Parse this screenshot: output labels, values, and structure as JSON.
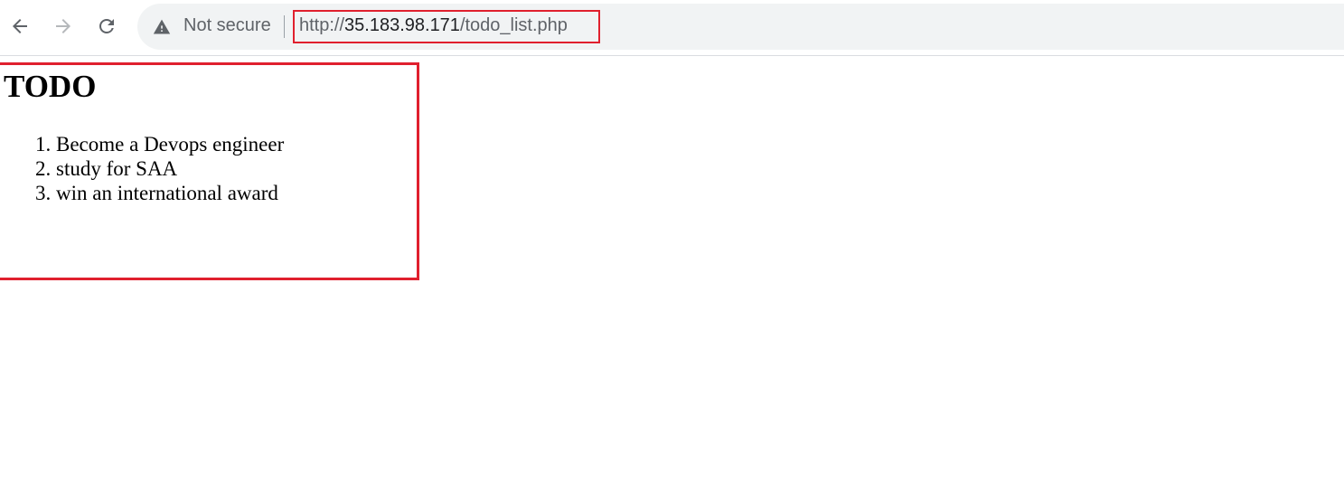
{
  "browser": {
    "nav": {
      "back_icon": "arrow-left-icon",
      "forward_icon": "arrow-right-icon",
      "reload_icon": "reload-icon"
    },
    "omnibox": {
      "security_icon": "warning-triangle-icon",
      "security_text": "Not secure",
      "url_scheme": "http://",
      "url_host": "35.183.98.171",
      "url_path": "/todo_list.php"
    }
  },
  "page": {
    "title": "TODO",
    "items": [
      "Become a Devops engineer",
      "study for SAA",
      "win an international award"
    ]
  },
  "colors": {
    "highlight": "#e0202e",
    "omnibox_bg": "#f1f3f4",
    "text_muted": "#5f6368"
  }
}
